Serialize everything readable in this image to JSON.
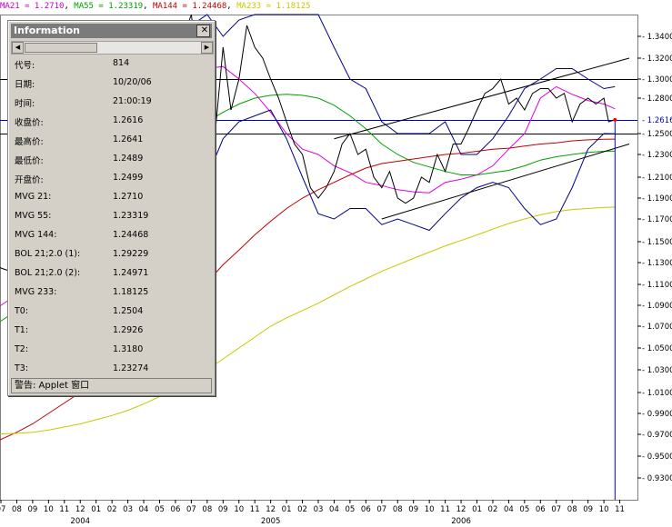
{
  "legend": [
    {
      "text": "MA21 = 1.2710",
      "color": "#c000c0"
    },
    {
      "text": ", ",
      "color": "#000000"
    },
    {
      "text": "MA55 = 1.23319",
      "color": "#00a000"
    },
    {
      "text": ", ",
      "color": "#000000"
    },
    {
      "text": "MA144 = 1.24468",
      "color": "#c00000"
    },
    {
      "text": ", ",
      "color": "#000000"
    },
    {
      "text": "MA233 = 1.18125",
      "color": "#c8c800"
    }
  ],
  "info_panel": {
    "title": "Information",
    "close_glyph": "✕",
    "status": "警告: Applet 窗口",
    "rows": [
      {
        "label": "代号:",
        "value": "814"
      },
      {
        "label": "日期:",
        "value": "10/20/06"
      },
      {
        "label": "时间:",
        "value": "21:00:19"
      },
      {
        "label": "收盘价:",
        "value": "1.2616"
      },
      {
        "label": "最高价:",
        "value": "1.2641"
      },
      {
        "label": "最低价:",
        "value": "1.2489"
      },
      {
        "label": "开盘价:",
        "value": "1.2499"
      },
      {
        "label": "MVG 21:",
        "value": "1.2710"
      },
      {
        "label": "MVG 55:",
        "value": "1.23319"
      },
      {
        "label": "MVG 144:",
        "value": "1.24468"
      },
      {
        "label": "BOL 21;2.0 (1):",
        "value": "1.29229"
      },
      {
        "label": "BOL 21;2.0 (2):",
        "value": "1.24971"
      },
      {
        "label": "MVG 233:",
        "value": "1.18125"
      },
      {
        "label": "T0:",
        "value": "1.2504"
      },
      {
        "label": "T1:",
        "value": "1.2926"
      },
      {
        "label": "T2:",
        "value": "1.3180"
      },
      {
        "label": "T3:",
        "value": "1.23274"
      }
    ]
  },
  "chart_data": {
    "type": "line",
    "yticks": [
      "1.3400",
      "1.3200",
      "1.3000",
      "1.2800",
      "1.2500",
      "1.2300",
      "1.2100",
      "1.1900",
      "1.1700",
      "1.1500",
      "1.1300",
      "1.1100",
      "1.0900",
      "1.0700",
      "1.0500",
      "1.0300",
      "1.0100",
      "0.9900",
      "0.9700",
      "0.9500",
      "0.9300"
    ],
    "ytick_values": [
      1.34,
      1.32,
      1.3,
      1.28,
      1.25,
      1.23,
      1.21,
      1.19,
      1.17,
      1.15,
      1.13,
      1.11,
      1.09,
      1.07,
      1.05,
      1.03,
      1.01,
      0.99,
      0.97,
      0.95,
      0.93
    ],
    "last_price_label": "1.2616",
    "last_price": 1.2616,
    "hlines": [
      1.3,
      1.2616,
      1.25
    ],
    "x_months": [
      "07",
      "08",
      "09",
      "10",
      "11",
      "12",
      "01",
      "02",
      "03",
      "04",
      "05",
      "06",
      "07",
      "08",
      "09",
      "10",
      "11",
      "12",
      "01",
      "02",
      "03",
      "04",
      "05",
      "06",
      "07",
      "08",
      "09",
      "10",
      "11",
      "12",
      "01",
      "02",
      "04",
      "05",
      "06",
      "07",
      "08",
      "09",
      "10",
      "11"
    ],
    "years": [
      {
        "label": "2004",
        "month_index": 5
      },
      {
        "label": "2005",
        "month_index": 17
      },
      {
        "label": "2006",
        "month_index": 29
      }
    ],
    "series": [
      {
        "name": "MA21",
        "color": "#e000e0",
        "x": [
          -0.5,
          1,
          2,
          3,
          4,
          5,
          6,
          7,
          8,
          9,
          10,
          11,
          12,
          13,
          14,
          15,
          16,
          17,
          18,
          19,
          20,
          21,
          22,
          23,
          24,
          25,
          26,
          27,
          28,
          29,
          30,
          31,
          32,
          33,
          34,
          35,
          36,
          37,
          38,
          38.7
        ],
        "y": [
          1.085,
          1.1,
          1.115,
          1.13,
          1.15,
          1.17,
          1.19,
          1.21,
          1.225,
          1.235,
          1.245,
          1.262,
          1.29,
          1.31,
          1.312,
          1.3,
          1.285,
          1.268,
          1.25,
          1.235,
          1.23,
          1.22,
          1.214,
          1.205,
          1.202,
          1.198,
          1.196,
          1.195,
          1.205,
          1.208,
          1.212,
          1.22,
          1.235,
          1.25,
          1.28,
          1.292,
          1.284,
          1.278,
          1.275,
          1.271
        ]
      },
      {
        "name": "MA55",
        "color": "#00a000",
        "x": [
          -0.5,
          1,
          2,
          3,
          4,
          5,
          6,
          7,
          8,
          9,
          10,
          11,
          12,
          13,
          14,
          15,
          16,
          17,
          18,
          19,
          20,
          21,
          22,
          23,
          24,
          25,
          26,
          27,
          28,
          29,
          30,
          31,
          32,
          33,
          34,
          35,
          36,
          37,
          38,
          38.7
        ],
        "y": [
          1.07,
          1.085,
          1.1,
          1.115,
          1.13,
          1.145,
          1.16,
          1.175,
          1.19,
          1.205,
          1.22,
          1.235,
          1.25,
          1.26,
          1.268,
          1.275,
          1.28,
          1.283,
          1.284,
          1.283,
          1.28,
          1.274,
          1.265,
          1.254,
          1.24,
          1.23,
          1.223,
          1.219,
          1.215,
          1.212,
          1.212,
          1.214,
          1.216,
          1.22,
          1.225,
          1.228,
          1.23,
          1.232,
          1.233,
          1.2332
        ]
      },
      {
        "name": "MA144",
        "color": "#c00000",
        "x": [
          -0.5,
          1,
          2,
          3,
          4,
          5,
          6,
          7,
          8,
          9,
          10,
          11,
          12,
          13,
          14,
          15,
          16,
          17,
          18,
          19,
          20,
          21,
          22,
          23,
          24,
          25,
          26,
          27,
          28,
          29,
          30,
          31,
          32,
          33,
          34,
          35,
          36,
          37,
          38,
          38.7
        ],
        "y": [
          0.962,
          0.972,
          0.98,
          0.99,
          1.0,
          1.01,
          1.022,
          1.034,
          1.046,
          1.058,
          1.07,
          1.083,
          1.097,
          1.112,
          1.128,
          1.142,
          1.156,
          1.168,
          1.18,
          1.19,
          1.198,
          1.205,
          1.212,
          1.218,
          1.222,
          1.224,
          1.226,
          1.228,
          1.23,
          1.231,
          1.233,
          1.235,
          1.236,
          1.238,
          1.24,
          1.241,
          1.243,
          1.244,
          1.2445,
          1.2447
        ]
      },
      {
        "name": "MA233",
        "color": "#c8c800",
        "x": [
          -0.5,
          1,
          2,
          3,
          4,
          5,
          6,
          7,
          8,
          9,
          10,
          11,
          12,
          13,
          14,
          15,
          16,
          17,
          18,
          19,
          20,
          21,
          22,
          23,
          24,
          25,
          26,
          27,
          28,
          29,
          30,
          31,
          32,
          33,
          34,
          35,
          36,
          37,
          38,
          38.7
        ],
        "y": [
          0.97,
          0.971,
          0.972,
          0.974,
          0.977,
          0.98,
          0.984,
          0.988,
          0.993,
          0.999,
          1.006,
          1.014,
          1.022,
          1.03,
          1.04,
          1.05,
          1.06,
          1.07,
          1.078,
          1.085,
          1.092,
          1.1,
          1.108,
          1.115,
          1.122,
          1.128,
          1.134,
          1.14,
          1.146,
          1.151,
          1.156,
          1.161,
          1.166,
          1.17,
          1.174,
          1.177,
          1.179,
          1.18,
          1.181,
          1.1813
        ]
      },
      {
        "name": "BOL upper",
        "color": "#00008b",
        "x": [
          7,
          8,
          9,
          10,
          11,
          12,
          13,
          14,
          15,
          16,
          17,
          18,
          19,
          20,
          21,
          22,
          23,
          24,
          25,
          26,
          27,
          28,
          29,
          30,
          31,
          32,
          33,
          34,
          35,
          36,
          37,
          38,
          38.7
        ],
        "y": [
          1.16,
          1.19,
          1.25,
          1.28,
          1.32,
          1.35,
          1.36,
          1.34,
          1.355,
          1.36,
          1.36,
          1.36,
          1.36,
          1.36,
          1.33,
          1.3,
          1.29,
          1.26,
          1.25,
          1.25,
          1.25,
          1.26,
          1.23,
          1.23,
          1.245,
          1.265,
          1.29,
          1.3,
          1.31,
          1.31,
          1.3,
          1.29,
          1.292
        ]
      },
      {
        "name": "BOL lower",
        "color": "#00008b",
        "x": [
          7,
          8,
          9,
          10,
          11,
          12,
          13,
          14,
          15,
          16,
          17,
          18,
          19,
          20,
          21,
          22,
          23,
          24,
          25,
          26,
          27,
          28,
          29,
          30,
          31,
          32,
          33,
          34,
          35,
          36,
          37,
          38,
          38.7
        ],
        "y": [
          1.12,
          1.15,
          1.19,
          1.2,
          1.175,
          1.2,
          1.21,
          1.245,
          1.26,
          1.265,
          1.27,
          1.245,
          1.21,
          1.175,
          1.17,
          1.18,
          1.18,
          1.165,
          1.17,
          1.165,
          1.16,
          1.175,
          1.19,
          1.2,
          1.205,
          1.2,
          1.18,
          1.165,
          1.17,
          1.2,
          1.235,
          1.25,
          1.2497
        ]
      },
      {
        "name": "Price",
        "color": "#000000",
        "x": [
          -0.5,
          0,
          1,
          2,
          3,
          4,
          5,
          6,
          7,
          8,
          9,
          10,
          10.5,
          11,
          11.5,
          12,
          12.5,
          13,
          13.5,
          14,
          14.5,
          15,
          15.5,
          16,
          16.5,
          17,
          17.5,
          18,
          18.5,
          19,
          19.5,
          20,
          20.5,
          21,
          21.5,
          22,
          22.5,
          23,
          23.5,
          24,
          24.5,
          25,
          25.5,
          26,
          26.5,
          27,
          27.5,
          28,
          28.5,
          29,
          29.5,
          30,
          30.5,
          31,
          31.5,
          32,
          32.5,
          33,
          33.5,
          34,
          34.5,
          35,
          35.5,
          36,
          36.5,
          37,
          37.5,
          38,
          38.3,
          38.7
        ],
        "y": [
          1.13,
          1.125,
          1.12,
          1.13,
          1.14,
          1.16,
          1.18,
          1.19,
          1.19,
          1.2,
          1.22,
          1.25,
          1.28,
          1.3,
          1.34,
          1.36,
          1.3,
          1.31,
          1.25,
          1.33,
          1.27,
          1.3,
          1.35,
          1.33,
          1.32,
          1.3,
          1.28,
          1.26,
          1.24,
          1.23,
          1.2,
          1.19,
          1.2,
          1.215,
          1.24,
          1.25,
          1.23,
          1.235,
          1.21,
          1.2,
          1.215,
          1.19,
          1.185,
          1.19,
          1.21,
          1.205,
          1.23,
          1.215,
          1.24,
          1.24,
          1.255,
          1.27,
          1.285,
          1.29,
          1.3,
          1.275,
          1.28,
          1.27,
          1.285,
          1.29,
          1.29,
          1.28,
          1.285,
          1.26,
          1.275,
          1.28,
          1.275,
          1.28,
          1.26,
          1.2616
        ]
      }
    ],
    "trendlines": [
      {
        "x": [
          21,
          39.6
        ],
        "y": [
          1.245,
          1.32
        ]
      },
      {
        "x": [
          24,
          39.6
        ],
        "y": [
          1.17,
          1.24
        ]
      }
    ]
  }
}
